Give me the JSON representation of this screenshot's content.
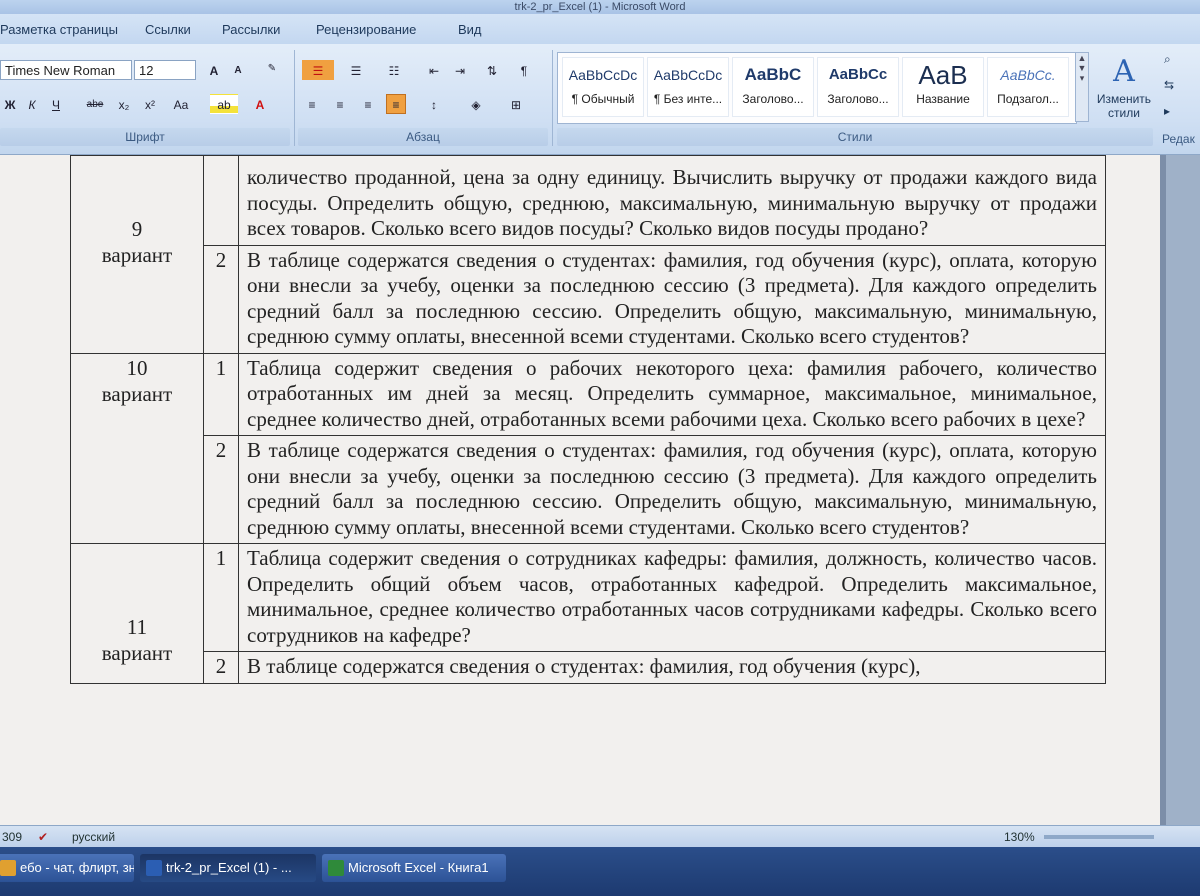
{
  "window": {
    "title": "trk-2_pr_Excel (1) - Microsoft Word"
  },
  "ribbon_tabs": [
    "Разметка страницы",
    "Ссылки",
    "Рассылки",
    "Рецензирование",
    "Вид"
  ],
  "font_group": {
    "font_name": "Times New Roman",
    "font_size": "12",
    "label": "Шрифт",
    "bold": "Ж",
    "italic": "К",
    "underline": "Ч",
    "strike": "abe",
    "subscript": "x₂",
    "superscript": "x²",
    "change_case": "Aa"
  },
  "paragraph_group": {
    "label": "Абзац"
  },
  "styles_group": {
    "label": "Стили",
    "styles": [
      {
        "sample": "AaBbCcDc",
        "name": "¶ Обычный"
      },
      {
        "sample": "AaBbCcDc",
        "name": "¶ Без инте..."
      },
      {
        "sample": "AaBbC",
        "name": "Заголово..."
      },
      {
        "sample": "AaBbCc",
        "name": "Заголово..."
      },
      {
        "sample": "AaB",
        "name": "Название"
      },
      {
        "sample": "AaBbCc.",
        "name": "Подзагол..."
      }
    ],
    "change_styles": "Изменить стили"
  },
  "editing_group": {
    "label": "Редак"
  },
  "document": {
    "rows": [
      {
        "variant": "9\nвариант",
        "tasks": [
          {
            "num": "",
            "text": "количество проданной, цена за одну единицу. Вычислить выручку от продажи каждого вида посуды. Определить общую, среднюю, максимальную, минимальную выручку от продажи всех товаров. Сколько всего видов посуды? Сколько видов посуды продано?"
          },
          {
            "num": "2",
            "text": "В таблице содержатся сведения о студентах: фамилия, год обучения (курс), оплата, которую они внесли за учебу, оценки за последнюю сессию (3 предмета). Для каждого определить средний балл за последнюю сессию. Определить общую, максимальную, минимальную, среднюю сумму оплаты, внесенной всеми студентами. Сколько всего студентов?"
          }
        ]
      },
      {
        "variant": "10\nвариант",
        "tasks": [
          {
            "num": "1",
            "text": "Таблица содержит сведения о рабочих некоторого цеха: фамилия рабочего, количество отработанных им дней за месяц. Определить суммарное, максимальное, минимальное, среднее количество дней, отработанных всеми рабочими цеха. Сколько всего рабочих в цехе?"
          },
          {
            "num": "2",
            "text": "В таблице содержатся сведения о студентах: фамилия, год обучения (курс), оплата, которую они внесли за учебу, оценки за последнюю сессию (3 предмета). Для каждого определить средний балл за последнюю сессию. Определить общую, максимальную, минимальную, среднюю сумму оплаты, внесенной всеми студентами. Сколько всего студентов?"
          }
        ]
      },
      {
        "variant": "11\nвариант",
        "tasks": [
          {
            "num": "1",
            "text": "Таблица содержит сведения о сотрудниках кафедры: фамилия, должность, количество часов. Определить общий объем часов, отработанных кафедрой. Определить максимальное, минимальное, среднее количество отработанных часов сотрудниками кафедры. Сколько всего сотрудников на кафедре?"
          },
          {
            "num": "2",
            "text": "В таблице содержатся сведения о студентах: фамилия, год обучения (курс),"
          }
        ]
      }
    ]
  },
  "statusbar": {
    "words": "309",
    "language": "русский",
    "zoom": "130%"
  },
  "taskbar": [
    {
      "label": "ебо - чат, флирт, зн...",
      "active": false,
      "color": "#e0a030"
    },
    {
      "label": "trk-2_pr_Excel (1) - ...",
      "active": true,
      "color": "#2b5eb3"
    },
    {
      "label": "Microsoft Excel - Книга1",
      "active": false,
      "color": "#2f8a3a"
    }
  ],
  "colors": {
    "ribbon": "#cfdff3",
    "page": "#f2f0ee",
    "taskbar": "#1d3a70"
  }
}
